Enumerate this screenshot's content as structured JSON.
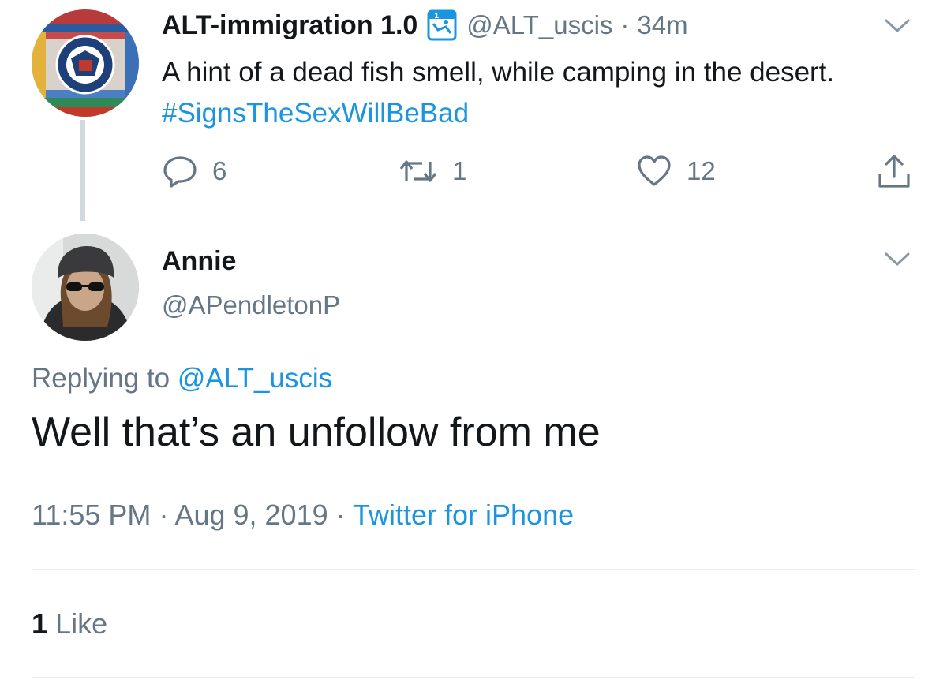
{
  "parent_tweet": {
    "display_name": "ALT-immigration 1.0",
    "handle": "@ALT_uscis",
    "separator": "·",
    "age": "34m",
    "text_plain": "A hint of a dead fish smell, while camping in the desert. ",
    "hashtag": "#SignsTheSexWillBeBad",
    "badge_icon": "cam-badge-icon",
    "actions": {
      "replies": "6",
      "retweets": "1",
      "likes": "12"
    }
  },
  "reply_tweet": {
    "display_name": "Annie",
    "handle": "@APendletonP",
    "replying_prefix": "Replying to ",
    "replying_to": "@ALT_uscis",
    "text": "Well that’s an unfollow from me",
    "time": "11:55 PM",
    "date": "Aug 9, 2019",
    "separator": "·",
    "source": "Twitter for iPhone",
    "like_count": "1",
    "like_label": "Like"
  },
  "colors": {
    "link": "#1b95e0",
    "secondary_text": "#657786",
    "primary_text": "#14171a",
    "divider": "#e6ecf0"
  }
}
